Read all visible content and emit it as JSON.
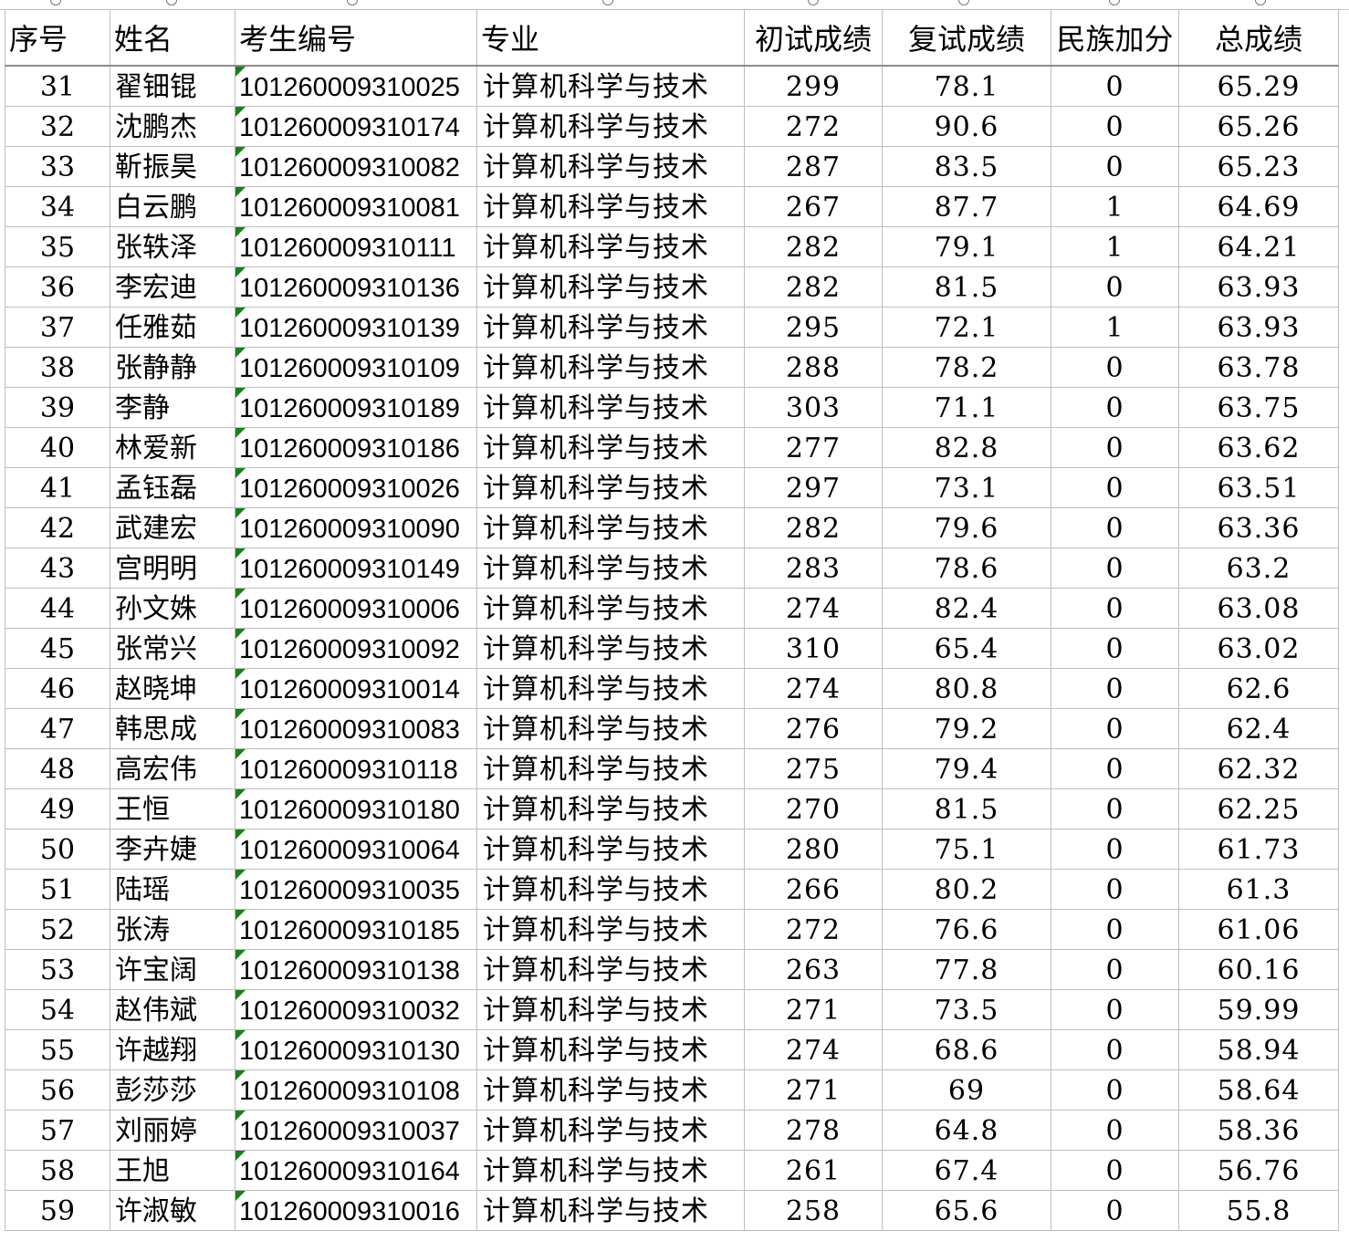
{
  "headers": {
    "seq": "序号",
    "name": "姓名",
    "id": "考生编号",
    "major": "专业",
    "prelim": "初试成绩",
    "retest": "复试成绩",
    "bonus": "民族加分",
    "total": "总成绩"
  },
  "rows": [
    [
      "31",
      "翟钿锟",
      "10126000931 0025",
      "计算机科学与技术",
      "299",
      "78.1",
      "0",
      "65.29"
    ],
    [
      "32",
      "沈鹏杰",
      "101260009310174",
      "计算机科学与技术",
      "272",
      "90.6",
      "0",
      "65.26"
    ],
    [
      "33",
      "靳振昊",
      "101260009310082",
      "计算机科学与技术",
      "287",
      "83.5",
      "0",
      "65.23"
    ],
    [
      "34",
      "白云鹏",
      "101260009310081",
      "计算机科学与技术",
      "267",
      "87.7",
      "1",
      "64.69"
    ],
    [
      "35",
      "张轶泽",
      "101260009310111",
      "计算机科学与技术",
      "282",
      "79.1",
      "1",
      "64.21"
    ],
    [
      "36",
      "李宏迪",
      "101260009310136",
      "计算机科学与技术",
      "282",
      "81.5",
      "0",
      "63.93"
    ],
    [
      "37",
      "任雅茹",
      "101260009310139",
      "计算机科学与技术",
      "295",
      "72.1",
      "1",
      "63.93"
    ],
    [
      "38",
      "张静静",
      "101260009310109",
      "计算机科学与技术",
      "288",
      "78.2",
      "0",
      "63.78"
    ],
    [
      "39",
      "李静",
      "101260009310189",
      "计算机科学与技术",
      "303",
      "71.1",
      "0",
      "63.75"
    ],
    [
      "40",
      "林爱新",
      "101260009310186",
      "计算机科学与技术",
      "277",
      "82.8",
      "0",
      "63.62"
    ],
    [
      "41",
      "孟钰磊",
      "101260009310026",
      "计算机科学与技术",
      "297",
      "73.1",
      "0",
      "63.51"
    ],
    [
      "42",
      "武建宏",
      "101260009310090",
      "计算机科学与技术",
      "282",
      "79.6",
      "0",
      "63.36"
    ],
    [
      "43",
      "宫明明",
      "101260009310149",
      "计算机科学与技术",
      "283",
      "78.6",
      "0",
      "63.2"
    ],
    [
      "44",
      "孙文姝",
      "101260009310006",
      "计算机科学与技术",
      "274",
      "82.4",
      "0",
      "63.08"
    ],
    [
      "45",
      "张常兴",
      "101260009310092",
      "计算机科学与技术",
      "310",
      "65.4",
      "0",
      "63.02"
    ],
    [
      "46",
      "赵晓坤",
      "101260009310014",
      "计算机科学与技术",
      "274",
      "80.8",
      "0",
      "62.6"
    ],
    [
      "47",
      "韩思成",
      "101260009310083",
      "计算机科学与技术",
      "276",
      "79.2",
      "0",
      "62.4"
    ],
    [
      "48",
      "高宏伟",
      "101260009310118",
      "计算机科学与技术",
      "275",
      "79.4",
      "0",
      "62.32"
    ],
    [
      "49",
      "王恒",
      "101260009310180",
      "计算机科学与技术",
      "270",
      "81.5",
      "0",
      "62.25"
    ],
    [
      "50",
      "李卉婕",
      "101260009310064",
      "计算机科学与技术",
      "280",
      "75.1",
      "0",
      "61.73"
    ],
    [
      "51",
      "陆瑶",
      "101260009310035",
      "计算机科学与技术",
      "266",
      "80.2",
      "0",
      "61.3"
    ],
    [
      "52",
      "张涛",
      "101260009310185",
      "计算机科学与技术",
      "272",
      "76.6",
      "0",
      "61.06"
    ],
    [
      "53",
      "许宝阔",
      "101260009310138",
      "计算机科学与技术",
      "263",
      "77.8",
      "0",
      "60.16"
    ],
    [
      "54",
      "赵伟斌",
      "101260009310032",
      "计算机科学与技术",
      "271",
      "73.5",
      "0",
      "59.99"
    ],
    [
      "55",
      "许越翔",
      "101260009310130",
      "计算机科学与技术",
      "274",
      "68.6",
      "0",
      "58.94"
    ],
    [
      "56",
      "彭莎莎",
      "101260009310108",
      "计算机科学与技术",
      "271",
      "69",
      "0",
      "58.64"
    ],
    [
      "57",
      "刘丽婷",
      "101260009310037",
      "计算机科学与技术",
      "278",
      "64.8",
      "0",
      "58.36"
    ],
    [
      "58",
      "王旭",
      "101260009310164",
      "计算机科学与技术",
      "261",
      "67.4",
      "0",
      "56.76"
    ],
    [
      "59",
      "许淑敏",
      "101260009310016",
      "计算机科学与技术",
      "258",
      "65.6",
      "0",
      "55.8"
    ]
  ]
}
